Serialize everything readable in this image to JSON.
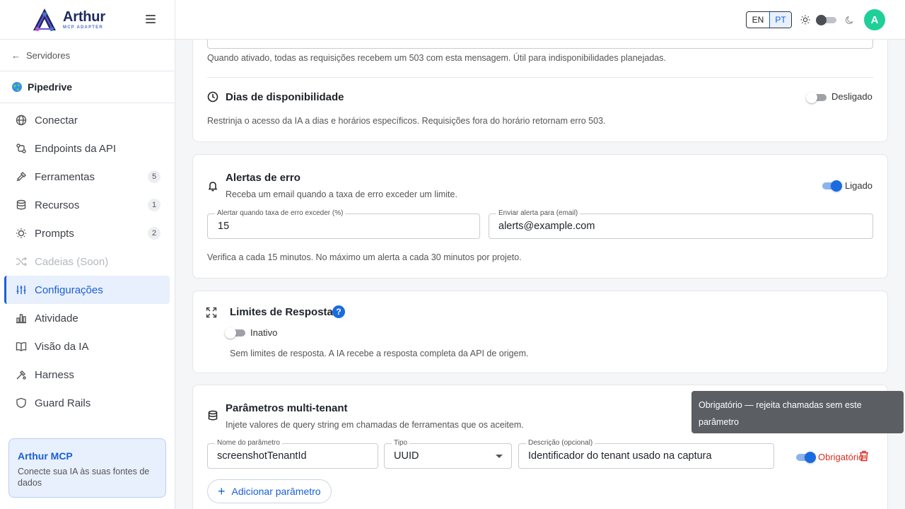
{
  "brand": {
    "name": "Arthur",
    "sub": "MCP ADAPTER"
  },
  "sidebar": {
    "back_label": "Servidores",
    "server_name": "Pipedrive",
    "items": [
      {
        "label": "Conectar",
        "icon": "globe-icon"
      },
      {
        "label": "Endpoints da API",
        "icon": "endpoints-icon"
      },
      {
        "label": "Ferramentas",
        "icon": "tools-icon",
        "badge": "5"
      },
      {
        "label": "Recursos",
        "icon": "database-icon",
        "badge": "1"
      },
      {
        "label": "Prompts",
        "icon": "bulb-icon",
        "badge": "2"
      },
      {
        "label": "Cadeias (Soon)",
        "icon": "shuffle-icon"
      },
      {
        "label": "Configurações",
        "icon": "sliders-icon"
      },
      {
        "label": "Atividade",
        "icon": "bar-chart-icon"
      },
      {
        "label": "Visão da IA",
        "icon": "book-icon"
      },
      {
        "label": "Harness",
        "icon": "harness-icon"
      },
      {
        "label": "Guard Rails",
        "icon": "shield-icon"
      }
    ],
    "promo": {
      "title": "Arthur MCP",
      "text": "Conecte sua IA às suas fontes de dados"
    }
  },
  "topbar": {
    "lang_en": "EN",
    "lang_pt": "PT",
    "avatar_letter": "A"
  },
  "maintenance": {
    "helper": "Quando ativado, todas as requisições recebem um 503 com esta mensagem. Útil para indisponibilidades planejadas."
  },
  "availability": {
    "title": "Dias de disponibilidade",
    "status": "Desligado",
    "helper": "Restrinja o acesso da IA a dias e horários específicos. Requisições fora do horário retornam erro 503."
  },
  "alerts": {
    "title": "Alertas de erro",
    "subtitle": "Receba um email quando a taxa de erro exceder um limite.",
    "status": "Ligado",
    "threshold_label": "Alertar quando taxa de erro exceder (%)",
    "threshold_value": "15",
    "email_label": "Enviar alerta para (email)",
    "email_value": "alerts@example.com",
    "helper": "Verifica a cada 15 minutos. No máximo um alerta a cada 30 minutos por projeto."
  },
  "limits": {
    "title": "Limites de Resposta",
    "help": "?",
    "status": "Inativo",
    "helper": "Sem limites de resposta. A IA recebe a resposta completa da API de origem."
  },
  "tenant": {
    "title": "Parâmetros multi-tenant",
    "subtitle": "Injete valores de query string em chamadas de ferramentas que os aceitem.",
    "name_label": "Nome do parâmetro",
    "name_value": "screenshotTenantId",
    "type_label": "Tipo",
    "type_value": "UUID",
    "desc_label": "Descrição (opcional)",
    "desc_value": "Identificador do tenant usado na captura",
    "required_label": "Obrigatório",
    "add_label": "Adicionar parâmetro",
    "tooltip": "Obrigatório — rejeita chamadas sem este parâmetro"
  },
  "colors": {
    "accent": "#1a5fd6",
    "danger": "#d93025",
    "avatar": "#1fcf9a"
  }
}
